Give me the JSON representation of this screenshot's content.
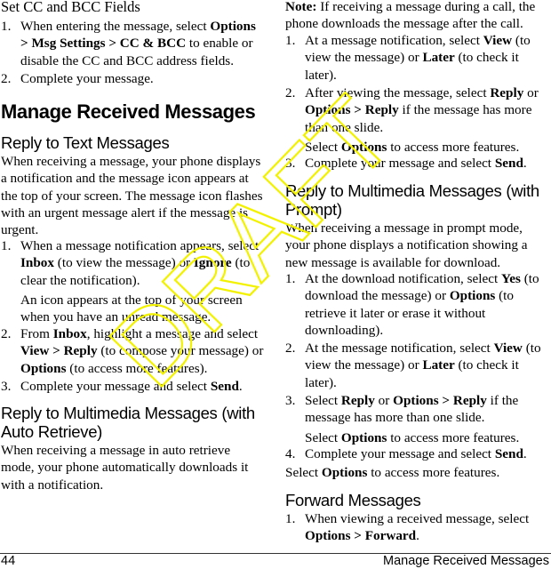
{
  "left": {
    "set_cc": {
      "heading": "Set CC and BCC Fields",
      "steps": [
        {
          "num": "1.",
          "parts": [
            {
              "t": "When entering the message, select ",
              "b": false
            },
            {
              "t": "Options > Msg Settings > CC & BCC",
              "b": true
            },
            {
              "t": " to enable or disable the CC and BCC address fields.",
              "b": false
            }
          ]
        },
        {
          "num": "2.",
          "parts": [
            {
              "t": "Complete your message.",
              "b": false
            }
          ]
        }
      ]
    },
    "section_title": "Manage Received Messages",
    "reply_text": {
      "heading": "Reply to Text Messages",
      "intro": "When receiving a message, your phone displays a notification and the message icon appears at the top of your screen. The message icon flashes with an urgent message alert if the message is urgent.",
      "steps": [
        {
          "num": "1.",
          "parts": [
            {
              "t": "When a message notification appears, select ",
              "b": false
            },
            {
              "t": "Inbox",
              "b": true
            },
            {
              "t": " (to view the message) or ",
              "b": false
            },
            {
              "t": "Ignore",
              "b": true
            },
            {
              "t": " (to clear the notification).",
              "b": false
            }
          ],
          "sub": "An icon appears at the top of your screen when you have an unread message."
        },
        {
          "num": "2.",
          "parts": [
            {
              "t": "From ",
              "b": false
            },
            {
              "t": "Inbox",
              "b": true
            },
            {
              "t": ", highlight a message and select ",
              "b": false
            },
            {
              "t": "View > Reply",
              "b": true
            },
            {
              "t": " (to compose your message) or ",
              "b": false
            },
            {
              "t": "Options",
              "b": true
            },
            {
              "t": " (to access more features).",
              "b": false
            }
          ]
        },
        {
          "num": "3.",
          "parts": [
            {
              "t": "Complete your message and select ",
              "b": false
            },
            {
              "t": "Send",
              "b": true
            },
            {
              "t": ".",
              "b": false
            }
          ]
        }
      ]
    },
    "reply_mm_auto": {
      "heading": "Reply to Multimedia Messages (with Auto Retrieve)",
      "intro": "When receiving a message in auto retrieve mode, your phone automatically downloads it with a notification."
    }
  },
  "right": {
    "note": {
      "label": "Note:",
      "text": " If receiving a message during a call, the phone downloads the message after the call."
    },
    "auto_steps": [
      {
        "num": "1.",
        "parts": [
          {
            "t": "At a message notification, select ",
            "b": false
          },
          {
            "t": "View",
            "b": true
          },
          {
            "t": " (to view the message) or ",
            "b": false
          },
          {
            "t": "Later",
            "b": true
          },
          {
            "t": " (to check it later).",
            "b": false
          }
        ]
      },
      {
        "num": "2.",
        "parts": [
          {
            "t": "After viewing the message, select ",
            "b": false
          },
          {
            "t": "Reply",
            "b": true
          },
          {
            "t": " or ",
            "b": false
          },
          {
            "t": "Options > Reply",
            "b": true
          },
          {
            "t": " if the message has more than one slide.",
            "b": false
          }
        ],
        "sub_parts": [
          {
            "t": "Select ",
            "b": false
          },
          {
            "t": "Options",
            "b": true
          },
          {
            "t": " to access more features.",
            "b": false
          }
        ]
      },
      {
        "num": "3.",
        "parts": [
          {
            "t": "Complete your message and select ",
            "b": false
          },
          {
            "t": "Send",
            "b": true
          },
          {
            "t": ".",
            "b": false
          }
        ]
      }
    ],
    "reply_mm_prompt": {
      "heading": "Reply to Multimedia Messages (with Prompt)",
      "intro": "When receiving a message in prompt mode, your phone displays a notification showing a new message is available for download.",
      "steps": [
        {
          "num": "1.",
          "parts": [
            {
              "t": "At the download notification, select ",
              "b": false
            },
            {
              "t": "Yes",
              "b": true
            },
            {
              "t": " (to download the message) or ",
              "b": false
            },
            {
              "t": "Options",
              "b": true
            },
            {
              "t": " (to retrieve it later or erase it without downloading).",
              "b": false
            }
          ]
        },
        {
          "num": "2.",
          "parts": [
            {
              "t": "At the message notification, select ",
              "b": false
            },
            {
              "t": "View",
              "b": true
            },
            {
              "t": " (to view the message) or ",
              "b": false
            },
            {
              "t": "Later",
              "b": true
            },
            {
              "t": " (to check it later).",
              "b": false
            }
          ]
        },
        {
          "num": "3.",
          "parts": [
            {
              "t": "Select ",
              "b": false
            },
            {
              "t": "Reply",
              "b": true
            },
            {
              "t": " or ",
              "b": false
            },
            {
              "t": "Options > Reply",
              "b": true
            },
            {
              "t": " if the message has more than one slide.",
              "b": false
            }
          ],
          "sub_parts": [
            {
              "t": "Select ",
              "b": false
            },
            {
              "t": "Options",
              "b": true
            },
            {
              "t": " to access more features.",
              "b": false
            }
          ]
        },
        {
          "num": "4.",
          "parts": [
            {
              "t": "Complete your message and select ",
              "b": false
            },
            {
              "t": "Send",
              "b": true
            },
            {
              "t": ".",
              "b": false
            }
          ]
        }
      ],
      "after": [
        {
          "t": "Select ",
          "b": false
        },
        {
          "t": "Options",
          "b": true
        },
        {
          "t": " to access more features.",
          "b": false
        }
      ]
    },
    "forward": {
      "heading": "Forward Messages",
      "steps": [
        {
          "num": "1.",
          "parts": [
            {
              "t": "When viewing a received message, select ",
              "b": false
            },
            {
              "t": "Options > Forward",
              "b": true
            },
            {
              "t": ".",
              "b": false
            }
          ]
        }
      ]
    }
  },
  "footer": {
    "page_number": "44",
    "running_title": "Manage Received Messages"
  },
  "watermark": {
    "text": "DRAFT",
    "color": "#f2f200"
  }
}
